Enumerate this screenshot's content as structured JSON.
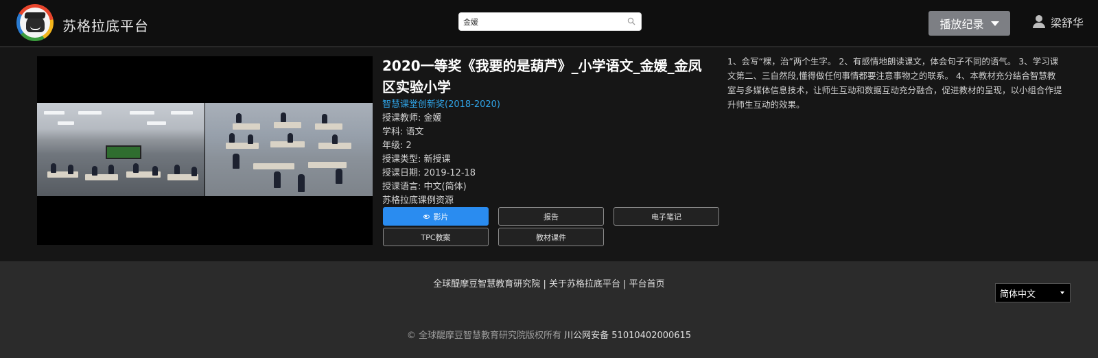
{
  "header": {
    "site_title": "苏格拉底平台",
    "search_value": "金媛",
    "play_record_label": "播放纪录",
    "user_name": "梁舒华"
  },
  "video": {
    "title": "2020一等奖《我要的是葫芦》_小学语文_金媛_金凤区实验小学",
    "award": "智慧课堂创新奖(2018-2020)",
    "meta": [
      "授课教师: 金媛",
      "学科: 语文",
      "年级: 2",
      "授课类型: 新授课",
      "授课日期: 2019-12-18",
      "授课语言: 中文(简体)",
      "苏格拉底课例资源"
    ],
    "buttons": {
      "film": "影片",
      "report": "报告",
      "e_notes": "电子笔记",
      "tpc_plan": "TPC教案",
      "materials": "教材课件"
    },
    "description": "1、会写“棵，治”两个生字。 2、有感情地朗读课文，体会句子不同的语气。 3、学习课文第二、三自然段,懂得做任何事情都要注意事物之的联系。 4、本教材充分结合智慧教室与多媒体信息技术，让师生互动和数据互动充分融合，促进教材的呈现，以小组合作提升师生互动的效果。"
  },
  "footer": {
    "link_institute": "全球醍摩豆智慧教育研究院",
    "separator": "|",
    "link_about": "关于苏格拉底平台",
    "link_home": "平台首页",
    "language": "简体中文",
    "copyright": "© 全球醍摩豆智慧教育研究院版权所有",
    "icp": "川公网安备 51010402000615"
  },
  "colors": {
    "accent_blue": "#2a8cf0",
    "award_link": "#2fa3e6",
    "header_bg": "#0f0f0f",
    "main_bg": "#161616",
    "footer_bg": "#2b2b2b"
  }
}
